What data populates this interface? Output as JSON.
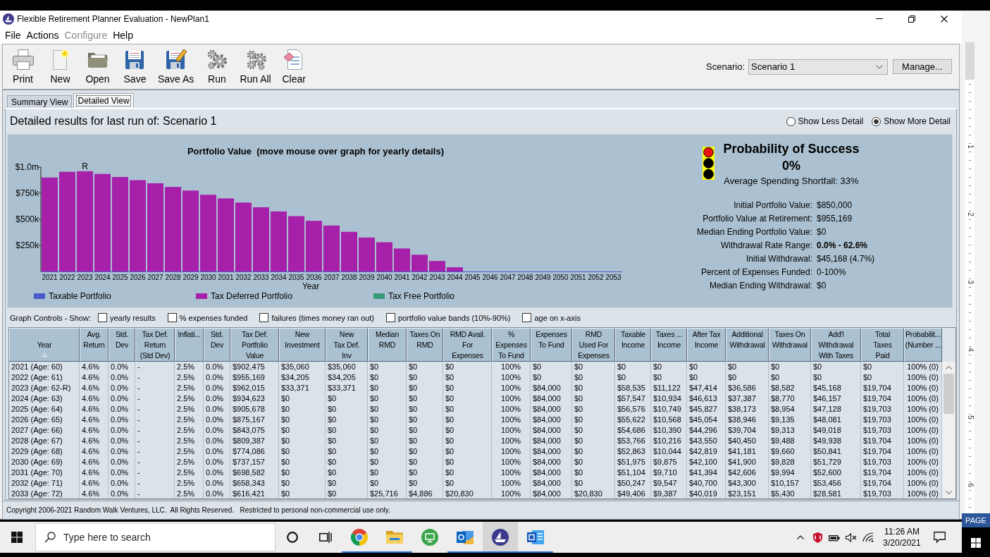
{
  "window": {
    "title": "Flexible Retirement Planner Evaluation - NewPlan1"
  },
  "menu": [
    {
      "label": "File",
      "disabled": false
    },
    {
      "label": "Actions",
      "disabled": false
    },
    {
      "label": "Configure",
      "disabled": true
    },
    {
      "label": "Help",
      "disabled": false
    }
  ],
  "toolbar": {
    "buttons": [
      {
        "label": "Print",
        "kind": "print"
      },
      {
        "label": "New",
        "kind": "new"
      },
      {
        "label": "Open",
        "kind": "open"
      },
      {
        "label": "Save",
        "kind": "save"
      },
      {
        "label": "Save As",
        "kind": "save_as"
      },
      {
        "label": "Run",
        "kind": "run"
      },
      {
        "label": "Run All",
        "kind": "run_all"
      },
      {
        "label": "Clear",
        "kind": "clear"
      }
    ],
    "scenario_label": "Scenario:",
    "scenario_value": "Scenario 1",
    "manage_button": "Manage..."
  },
  "tabs": [
    {
      "label": "Summary View",
      "selected": false
    },
    {
      "label": "Detailed View",
      "selected": true
    }
  ],
  "results": {
    "heading": "Detailed results for last run of: Scenario 1",
    "detail_options": [
      {
        "label": "Show Less Detail",
        "selected": false
      },
      {
        "label": "Show More Detail",
        "selected": true
      }
    ]
  },
  "chart_panel": {
    "chart_data": {
      "type": "bar",
      "title": "Portfolio Value  (move mouse over graph for yearly details)",
      "xlabel": "Year",
      "categories": [
        "2021",
        "2022",
        "2023",
        "2024",
        "2025",
        "2026",
        "2027",
        "2028",
        "2029",
        "2030",
        "2031",
        "2032",
        "2033",
        "2034",
        "2035",
        "2036",
        "2037",
        "2038",
        "2039",
        "2040",
        "2041",
        "2042",
        "2043",
        "2044",
        "2045",
        "2046",
        "2047",
        "2048",
        "2049",
        "2050",
        "2051",
        "2052",
        "2053"
      ],
      "series": [
        {
          "name": "Taxable Portfolio",
          "color": "#4b5bc8",
          "values": [
            0,
            0,
            0,
            0,
            0,
            0,
            0,
            0,
            0,
            0,
            0,
            0,
            0,
            0,
            0,
            0,
            0,
            0,
            0,
            0,
            0,
            0,
            0,
            0,
            0,
            0,
            0,
            0,
            0,
            0,
            0,
            0,
            0
          ]
        },
        {
          "name": "Tax Deferred Portfolio",
          "color": "#a620aa",
          "values": [
            900000,
            955000,
            960000,
            935000,
            905000,
            875000,
            845000,
            810000,
            775000,
            735000,
            700000,
            660000,
            615000,
            575000,
            530000,
            485000,
            440000,
            380000,
            325000,
            280000,
            220000,
            160000,
            100000,
            40000,
            0,
            0,
            0,
            0,
            0,
            0,
            0,
            0,
            0
          ]
        },
        {
          "name": "Tax Free Portfolio",
          "color": "#3c9a7c",
          "values": [
            0,
            0,
            0,
            0,
            0,
            0,
            0,
            0,
            0,
            0,
            0,
            0,
            0,
            0,
            0,
            0,
            0,
            0,
            0,
            0,
            0,
            0,
            0,
            0,
            0,
            0,
            0,
            0,
            0,
            0,
            0,
            0,
            0
          ]
        }
      ],
      "ylim": [
        0,
        1000000
      ],
      "yticks": [
        {
          "value": 250000,
          "label": "$250k"
        },
        {
          "value": 500000,
          "label": "$500k"
        },
        {
          "value": 750000,
          "label": "$750k"
        },
        {
          "value": 1000000,
          "label": "$1.0m"
        }
      ],
      "stacked": true,
      "annotations": [
        {
          "x": "2023",
          "y": 960000,
          "text": "R"
        }
      ]
    }
  },
  "probability": {
    "lights": [
      {
        "lit": true
      },
      {
        "lit": false
      },
      {
        "lit": false
      }
    ],
    "title": "Probability of Success",
    "value": "0%",
    "shortfall": "Average Spending Shortfall: 33%",
    "stats": [
      {
        "label": "Initial Portfolio Value:",
        "value": "$850,000",
        "bold": false
      },
      {
        "label": "Portfolio Value at Retirement:",
        "value": "$955,169",
        "bold": false
      },
      {
        "label": "Median Ending Portfolio Value:",
        "value": "$0",
        "bold": false
      },
      {
        "label": "Withdrawal Rate Range:",
        "value": "0.0% - 62.6%",
        "bold": true
      },
      {
        "label": "Initial Withdrawal:",
        "value": "$45,168 (4.7%)",
        "bold": false
      },
      {
        "label": "Percent of Expenses Funded:",
        "value": "0-100%",
        "bold": false
      },
      {
        "label": "Median Ending Withdrawal:",
        "value": "$0",
        "bold": false
      }
    ]
  },
  "graph_controls": {
    "label": "Graph Controls - Show:",
    "options": [
      {
        "label": "yearly results",
        "checked": false
      },
      {
        "label": "% expenses funded",
        "checked": false
      },
      {
        "label": "failures (times money ran out)",
        "checked": false
      },
      {
        "label": "portfolio value bands (10%-90%)",
        "checked": false
      },
      {
        "label": "age on x-axis",
        "checked": false
      }
    ]
  },
  "table": {
    "columns": [
      {
        "lines": [
          "Year"
        ],
        "sorted": true
      },
      {
        "lines": [
          "Avg.",
          "Return"
        ],
        "sorted": false
      },
      {
        "lines": [
          "Std.",
          "Dev"
        ],
        "sorted": false
      },
      {
        "lines": [
          "Tax Def.",
          "Return",
          "(Std Dev)"
        ],
        "sorted": false
      },
      {
        "lines": [
          "Inflati..."
        ],
        "sorted": false
      },
      {
        "lines": [
          "Std.",
          "Dev"
        ],
        "sorted": false
      },
      {
        "lines": [
          "Tax Def.",
          "Portfolio",
          "Value"
        ],
        "sorted": false
      },
      {
        "lines": [
          "New",
          "Investment"
        ],
        "sorted": false
      },
      {
        "lines": [
          "New",
          "Tax Def.",
          "Inv"
        ],
        "sorted": false
      },
      {
        "lines": [
          "Median",
          "RMD"
        ],
        "sorted": false
      },
      {
        "lines": [
          "Taxes On",
          "RMD"
        ],
        "sorted": false
      },
      {
        "lines": [
          "RMD Avail.",
          "For",
          "Expenses"
        ],
        "sorted": false
      },
      {
        "lines": [
          "%",
          "Expenses",
          "To Fund"
        ],
        "sorted": false
      },
      {
        "lines": [
          "Expenses",
          "To Fund"
        ],
        "sorted": false
      },
      {
        "lines": [
          "RMD",
          "Used For",
          "Expenses"
        ],
        "sorted": false
      },
      {
        "lines": [
          "Taxable",
          "Income"
        ],
        "sorted": false
      },
      {
        "lines": [
          "Taxes ...",
          "Income"
        ],
        "sorted": false
      },
      {
        "lines": [
          "After Tax",
          "Income"
        ],
        "sorted": false
      },
      {
        "lines": [
          "Additional",
          "Withdrawal"
        ],
        "sorted": false
      },
      {
        "lines": [
          "Taxes On",
          "Withdrawal"
        ],
        "sorted": false
      },
      {
        "lines": [
          "Add'l",
          "Withdrawal",
          "With Taxes"
        ],
        "sorted": false
      },
      {
        "lines": [
          "Total",
          "Taxes",
          "Paid"
        ],
        "sorted": false
      },
      {
        "lines": [
          "Probabilit...",
          "(Number ..."
        ],
        "sorted": false
      }
    ],
    "rows": [
      [
        "2021 (Age: 60)",
        "4.6%",
        "0.0%",
        "-",
        "2.5%",
        "0.0%",
        "$902,475",
        "$35,060",
        "$35,060",
        "$0",
        "$0",
        "$0",
        "100%",
        "$0",
        "$0",
        "$0",
        "$0",
        "$0",
        "$0",
        "$0",
        "$0",
        "$0",
        "100% (0)"
      ],
      [
        "2022 (Age: 61)",
        "4.6%",
        "0.0%",
        "-",
        "2.5%",
        "0.0%",
        "$955,169",
        "$34,205",
        "$34,205",
        "$0",
        "$0",
        "$0",
        "100%",
        "$0",
        "$0",
        "$0",
        "$0",
        "$0",
        "$0",
        "$0",
        "$0",
        "$0",
        "100% (0)"
      ],
      [
        "2023 (Age: 62-R)",
        "4.6%",
        "0.0%",
        "-",
        "2.5%",
        "0.0%",
        "$962,015",
        "$33,371",
        "$33,371",
        "$0",
        "$0",
        "$0",
        "100%",
        "$84,000",
        "$0",
        "$58,535",
        "$11,122",
        "$47,414",
        "$36,586",
        "$8,582",
        "$45,168",
        "$19,704",
        "100% (0)"
      ],
      [
        "2024 (Age: 63)",
        "4.6%",
        "0.0%",
        "-",
        "2.5%",
        "0.0%",
        "$934,623",
        "$0",
        "$0",
        "$0",
        "$0",
        "$0",
        "100%",
        "$84,000",
        "$0",
        "$57,547",
        "$10,934",
        "$46,613",
        "$37,387",
        "$8,770",
        "$46,157",
        "$19,704",
        "100% (0)"
      ],
      [
        "2025 (Age: 64)",
        "4.6%",
        "0.0%",
        "-",
        "2.5%",
        "0.0%",
        "$905,678",
        "$0",
        "$0",
        "$0",
        "$0",
        "$0",
        "100%",
        "$84,000",
        "$0",
        "$56,576",
        "$10,749",
        "$45,827",
        "$38,173",
        "$8,954",
        "$47,128",
        "$19,703",
        "100% (0)"
      ],
      [
        "2026 (Age: 65)",
        "4.6%",
        "0.0%",
        "-",
        "2.5%",
        "0.0%",
        "$875,167",
        "$0",
        "$0",
        "$0",
        "$0",
        "$0",
        "100%",
        "$84,000",
        "$0",
        "$55,622",
        "$10,568",
        "$45,054",
        "$38,946",
        "$9,135",
        "$48,081",
        "$19,703",
        "100% (0)"
      ],
      [
        "2027 (Age: 66)",
        "4.6%",
        "0.0%",
        "-",
        "2.5%",
        "0.0%",
        "$843,075",
        "$0",
        "$0",
        "$0",
        "$0",
        "$0",
        "100%",
        "$84,000",
        "$0",
        "$54,686",
        "$10,390",
        "$44,296",
        "$39,704",
        "$9,313",
        "$49,018",
        "$19,703",
        "100% (0)"
      ],
      [
        "2028 (Age: 67)",
        "4.6%",
        "0.0%",
        "-",
        "2.5%",
        "0.0%",
        "$809,387",
        "$0",
        "$0",
        "$0",
        "$0",
        "$0",
        "100%",
        "$84,000",
        "$0",
        "$53,766",
        "$10,216",
        "$43,550",
        "$40,450",
        "$9,488",
        "$49,938",
        "$19,704",
        "100% (0)"
      ],
      [
        "2029 (Age: 68)",
        "4.6%",
        "0.0%",
        "-",
        "2.5%",
        "0.0%",
        "$774,086",
        "$0",
        "$0",
        "$0",
        "$0",
        "$0",
        "100%",
        "$84,000",
        "$0",
        "$52,863",
        "$10,044",
        "$42,819",
        "$41,181",
        "$9,660",
        "$50,841",
        "$19,704",
        "100% (0)"
      ],
      [
        "2030 (Age: 69)",
        "4.6%",
        "0.0%",
        "-",
        "2.5%",
        "0.0%",
        "$737,157",
        "$0",
        "$0",
        "$0",
        "$0",
        "$0",
        "100%",
        "$84,000",
        "$0",
        "$51,975",
        "$9,875",
        "$42,100",
        "$41,900",
        "$9,828",
        "$51,729",
        "$19,703",
        "100% (0)"
      ],
      [
        "2031 (Age: 70)",
        "4.6%",
        "0.0%",
        "-",
        "2.5%",
        "0.0%",
        "$698,582",
        "$0",
        "$0",
        "$0",
        "$0",
        "$0",
        "100%",
        "$84,000",
        "$0",
        "$51,104",
        "$9,710",
        "$41,394",
        "$42,606",
        "$9,994",
        "$52,600",
        "$19,704",
        "100% (0)"
      ],
      [
        "2032 (Age: 71)",
        "4.6%",
        "0.0%",
        "-",
        "2.5%",
        "0.0%",
        "$658,343",
        "$0",
        "$0",
        "$0",
        "$0",
        "$0",
        "100%",
        "$84,000",
        "$0",
        "$50,247",
        "$9,547",
        "$40,700",
        "$43,300",
        "$10,157",
        "$53,456",
        "$19,704",
        "100% (0)"
      ],
      [
        "2033 (Age: 72)",
        "4.6%",
        "0.0%",
        "-",
        "2.5%",
        "0.0%",
        "$616,421",
        "$0",
        "$0",
        "$25,716",
        "$4,886",
        "$20,830",
        "100%",
        "$84,000",
        "$20,830",
        "$49,406",
        "$9,387",
        "$40,019",
        "$23,151",
        "$5,430",
        "$28,581",
        "$19,703",
        "100% (0)"
      ]
    ]
  },
  "footer": "Copyright 2006-2021 Random Walk Ventures, LLC.  All Rights Reserved.   Restricted to personal non-commercial use only.",
  "taskbar": {
    "search_placeholder": "Type here to search",
    "apps": [
      {
        "kind": "browser",
        "running": true,
        "active": false
      },
      {
        "kind": "folder",
        "running": true,
        "active": false
      },
      {
        "kind": "presentation",
        "running": false,
        "active": false
      },
      {
        "kind": "mail",
        "running": true,
        "active": false
      },
      {
        "kind": "planner",
        "running": true,
        "active": true
      },
      {
        "kind": "document",
        "running": true,
        "active": false
      }
    ],
    "time": "11:26 AM",
    "date": "3/20/2021"
  },
  "side_ruler": {
    "marks": [
      "1",
      "2",
      "3",
      "4",
      "5",
      "6"
    ],
    "badge": "PAGE"
  }
}
